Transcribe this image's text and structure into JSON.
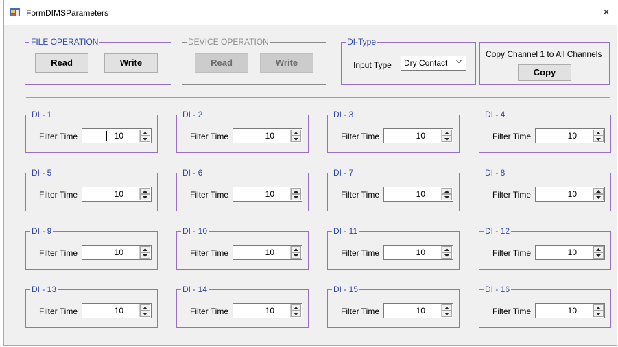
{
  "window": {
    "title": "FormDIMSParameters",
    "close_glyph": "×",
    "app_icon": "form-icon"
  },
  "file_operation": {
    "legend": "FILE OPERATION",
    "read_label": "Read",
    "write_label": "Write"
  },
  "device_operation": {
    "legend": "DEVICE OPERATION",
    "read_label": "Read",
    "write_label": "Write",
    "enabled": false
  },
  "di_type": {
    "legend": "DI-Type",
    "input_type_label": "Input Type",
    "selected": "Dry Contact"
  },
  "copy_group": {
    "caption": "Copy Channel 1 to All Channels",
    "copy_label": "Copy"
  },
  "channels": [
    {
      "legend": "DI - 1",
      "filter_label": "Filter Time",
      "value": "10"
    },
    {
      "legend": "DI - 2",
      "filter_label": "Filter Time",
      "value": "10"
    },
    {
      "legend": "DI - 3",
      "filter_label": "Filter Time",
      "value": "10"
    },
    {
      "legend": "DI - 4",
      "filter_label": "Filter Time",
      "value": "10"
    },
    {
      "legend": "DI - 5",
      "filter_label": "Filter Time",
      "value": "10"
    },
    {
      "legend": "DI - 6",
      "filter_label": "Filter Time",
      "value": "10"
    },
    {
      "legend": "DI - 7",
      "filter_label": "Filter Time",
      "value": "10"
    },
    {
      "legend": "DI - 8",
      "filter_label": "Filter Time",
      "value": "10"
    },
    {
      "legend": "DI - 9",
      "filter_label": "Filter Time",
      "value": "10"
    },
    {
      "legend": "DI - 10",
      "filter_label": "Filter Time",
      "value": "10"
    },
    {
      "legend": "DI - 11",
      "filter_label": "Filter Time",
      "value": "10"
    },
    {
      "legend": "DI - 12",
      "filter_label": "Filter Time",
      "value": "10"
    },
    {
      "legend": "DI - 13",
      "filter_label": "Filter Time",
      "value": "10"
    },
    {
      "legend": "DI - 14",
      "filter_label": "Filter Time",
      "value": "10"
    },
    {
      "legend": "DI - 15",
      "filter_label": "Filter Time",
      "value": "10"
    },
    {
      "legend": "DI - 16",
      "filter_label": "Filter Time",
      "value": "10"
    }
  ],
  "colors": {
    "group_border": "#9a6dc7",
    "legend_text": "#3146a8",
    "disabled_text": "#8d8d8d",
    "form_background": "#f0f0f0"
  }
}
